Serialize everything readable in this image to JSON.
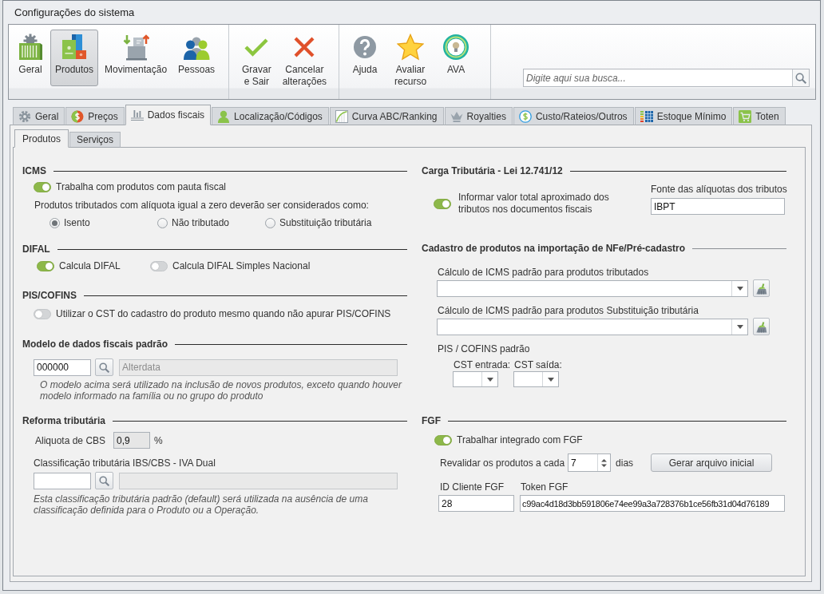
{
  "window": {
    "title": "Configurações do sistema"
  },
  "toolbar": {
    "modules": [
      {
        "label": "Geral",
        "selected": false
      },
      {
        "label": "Produtos",
        "selected": true
      },
      {
        "label": "Movimentação",
        "selected": false
      },
      {
        "label": "Pessoas",
        "selected": false
      }
    ],
    "actions": [
      "Gravar e Sair",
      "Cancelar alterações"
    ],
    "help": [
      "Ajuda",
      "Avaliar recurso",
      "AVA"
    ],
    "search": {
      "placeholder": "Digite aqui sua busca..."
    }
  },
  "tabs": [
    {
      "label": "Geral",
      "selected": false
    },
    {
      "label": "Preços",
      "selected": false
    },
    {
      "label": "Dados fiscais",
      "selected": true
    },
    {
      "label": "Localização/Códigos",
      "selected": false
    },
    {
      "label": "Curva ABC/Ranking",
      "selected": false
    },
    {
      "label": "Royalties",
      "selected": false
    },
    {
      "label": "Custo/Rateios/Outros",
      "selected": false
    },
    {
      "label": "Estoque Mínimo",
      "selected": false
    },
    {
      "label": "Toten",
      "selected": false
    }
  ],
  "subtabs": [
    {
      "label": "Produtos",
      "selected": true
    },
    {
      "label": "Serviços",
      "selected": false
    }
  ],
  "icms": {
    "title": "ICMS",
    "pauta_fiscal": {
      "label": "Trabalha com produtos com pauta fiscal",
      "on": true
    },
    "zero_rate_prompt": "Produtos tributados com alíquota igual a zero deverão ser considerados como:",
    "zero_rate_options": [
      {
        "label": "Isento",
        "selected": true
      },
      {
        "label": "Não tributado",
        "selected": false
      },
      {
        "label": "Substituição tributária",
        "selected": false
      }
    ]
  },
  "difal": {
    "title": "DIFAL",
    "options": [
      {
        "label": "Calcula DIFAL",
        "on": true
      },
      {
        "label": "Calcula DIFAL Simples Nacional",
        "on": false
      }
    ]
  },
  "pis_cofins": {
    "title": "PIS/COFINS",
    "cst_cadastro": {
      "label": "Utilizar o CST do cadastro do produto mesmo quando não apurar PIS/COFINS",
      "on": false
    }
  },
  "modelo_padrao": {
    "title": "Modelo de dados fiscais padrão",
    "code_field": {
      "value": "000000",
      "disabled": false
    },
    "description_field": {
      "value": "Alterdata",
      "disabled": true
    },
    "note": "O modelo acima será utilizado na inclusão de novos produtos, exceto quando houver modelo informado na família ou no grupo do produto"
  },
  "reforma_tributaria": {
    "title": "Reforma tributária",
    "cbs": {
      "label": "Aliquota de CBS",
      "value": "0,9",
      "readonly": true,
      "unit": "%"
    },
    "classificacao": {
      "label": "Classificação tributária IBS/CBS - IVA Dual",
      "code_field": {
        "disabled": false
      },
      "description_field": {
        "disabled": true
      }
    },
    "note": "Esta classificação tributária padrão (default) será utilizada na ausência de uma classificação definida para o Produto ou a Operação."
  },
  "carga_tributaria": {
    "title": "Carga Tributária - Lei 12.741/12",
    "informar_total": {
      "label": "Informar valor total aproximado dos tributos nos documentos fiscais",
      "on": true
    },
    "fonte": {
      "label": "Fonte das alíquotas dos tributos",
      "value": "IBPT"
    }
  },
  "cadastro_importacao": {
    "title": "Cadastro de produtos na importação de NFe/Pré-cadastro",
    "icms_defaults": [
      {
        "label": "Cálculo de ICMS padrão para produtos tributados"
      },
      {
        "label": "Cálculo de ICMS padrão para produtos Substituição tributária"
      }
    ],
    "pis_cofins_title": "PIS / COFINS padrão",
    "cst": [
      {
        "label": "CST entrada:"
      },
      {
        "label": "CST saída:"
      }
    ]
  },
  "fgf": {
    "title": "FGF",
    "integrado": {
      "label": "Trabalhar integrado com FGF",
      "on": true
    },
    "revalidar": {
      "label": "Revalidar os produtos a cada",
      "value": "7",
      "unit": "dias"
    },
    "gerar_button": "Gerar arquivo inicial",
    "id_cliente": {
      "label": "ID Cliente FGF",
      "value": "28"
    },
    "token": {
      "label": "Token FGF",
      "value": "c99ac4d18d3bb591806e74ee99a3a728376b1ce56fb31d04d76189"
    }
  }
}
